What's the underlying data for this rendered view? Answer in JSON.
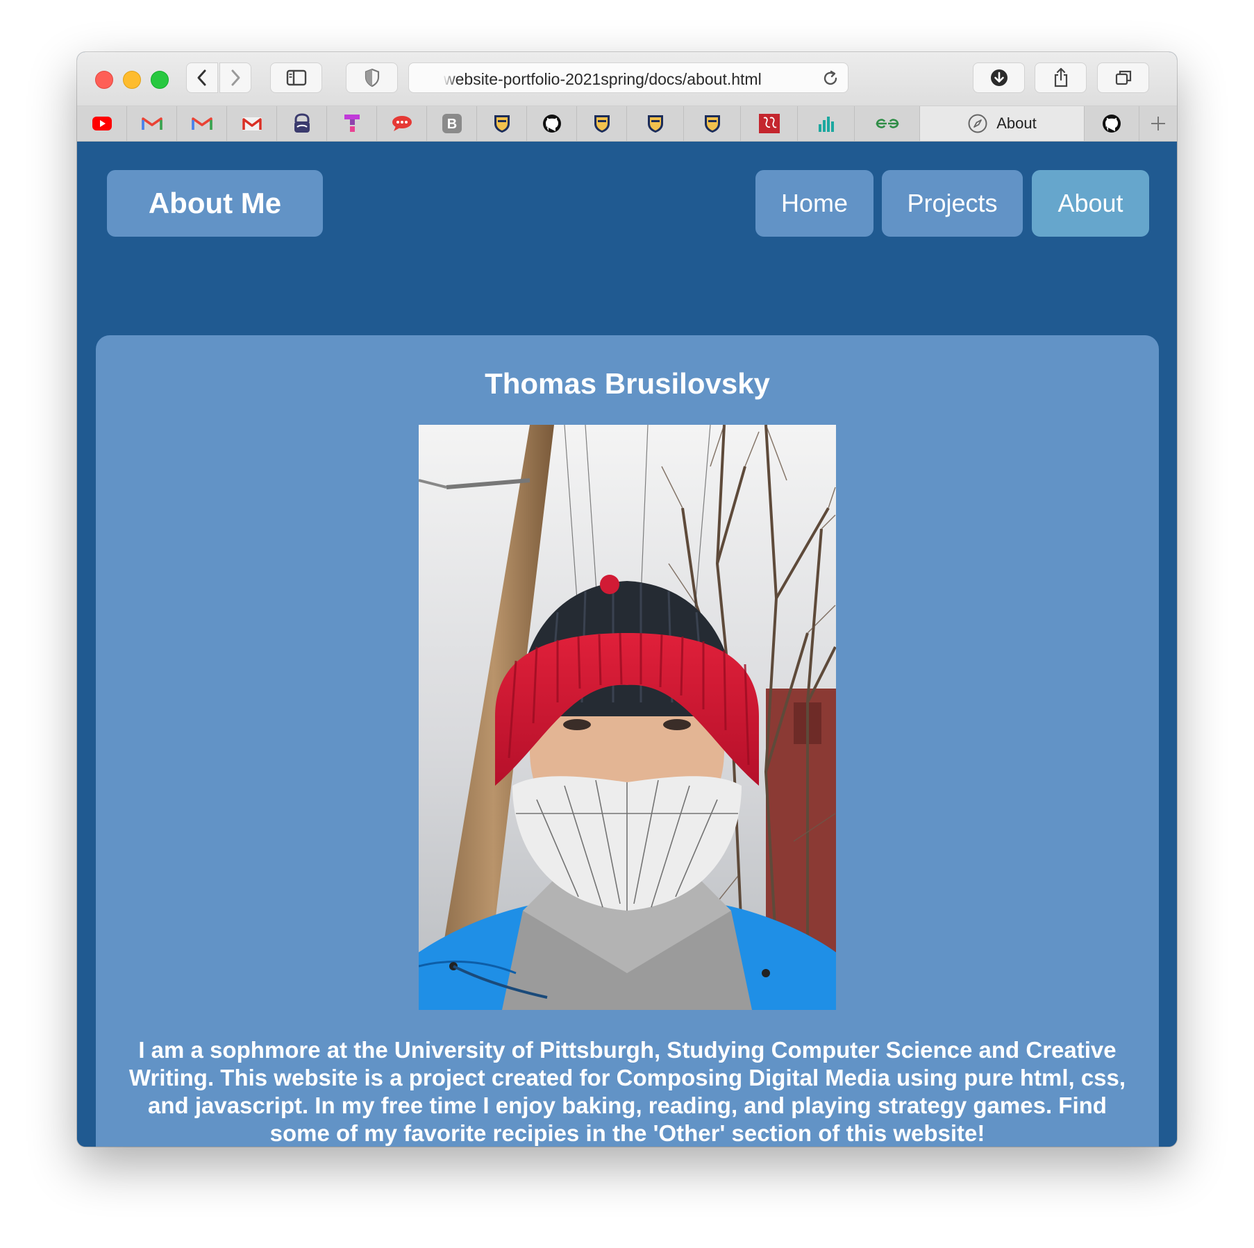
{
  "browser": {
    "url": "website-portfolio-2021spring/docs/about.html",
    "active_tab_title": "About",
    "pinned_tabs": [
      {
        "icon": "youtube-icon",
        "color": "#ff0000"
      },
      {
        "icon": "gmail-icon",
        "color": "#ea4335"
      },
      {
        "icon": "gmail-icon",
        "color": "#ea4335"
      },
      {
        "icon": "gmail-old-icon",
        "color": "#d93025"
      },
      {
        "icon": "proton-vpn-icon",
        "color": "#3b3b6e"
      },
      {
        "icon": "tinder-t-icon",
        "color": "#c13ad9"
      },
      {
        "icon": "speech-bubble-icon",
        "color": "#e53935"
      },
      {
        "icon": "letter-b-icon",
        "color": "#8a8a8a"
      },
      {
        "icon": "pitt-shield-icon",
        "color": "#1c2d5a"
      },
      {
        "icon": "github-icon",
        "color": "#111111"
      },
      {
        "icon": "pitt-shield-icon",
        "color": "#1c2d5a"
      },
      {
        "icon": "pitt-shield-icon",
        "color": "#1c2d5a"
      },
      {
        "icon": "pitt-shield-icon",
        "color": "#1c2d5a"
      },
      {
        "icon": "jstor-icon",
        "color": "#c4262e"
      },
      {
        "icon": "bar-chart-icon",
        "color": "#1da8a0"
      },
      {
        "icon": "geeksforgeeks-icon",
        "color": "#2f8d46"
      }
    ]
  },
  "site": {
    "brand": "About Me",
    "nav": {
      "home": "Home",
      "projects": "Projects",
      "about": "About"
    },
    "colors": {
      "page_background": "#205a91",
      "panel": "#6293c6",
      "active_nav": "#66a6cc"
    }
  },
  "content": {
    "name": "Thomas Brusilovsky",
    "photo_alt": "selfie-photo",
    "bio": "I am a sophmore at the University of Pittsburgh, Studying Computer Science and Creative Writing. This website is a project created for Composing Digital Media using pure html, css, and javascript. In my free time I enjoy baking, reading, and playing strategy games. Find some of my favorite recipies in the 'Other' section of this website!"
  }
}
